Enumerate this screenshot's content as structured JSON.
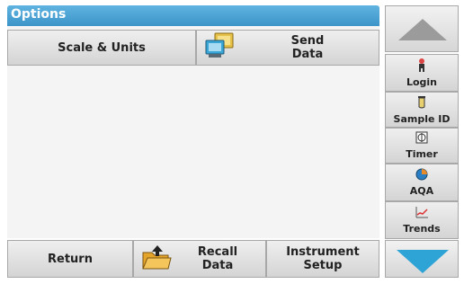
{
  "header": {
    "title": "Options"
  },
  "main": {
    "scale_units_label": "Scale & Units",
    "send_data_label": "Send\nData"
  },
  "footer": {
    "return_label": "Return",
    "recall_data_label": "Recall\nData",
    "instrument_setup_label": "Instrument\nSetup"
  },
  "sidebar": {
    "login_label": "Login",
    "sample_id_label": "Sample ID",
    "timer_label": "Timer",
    "aqa_label": "AQA",
    "trends_label": "Trends"
  },
  "colors": {
    "title_bar": "#4aa3d6",
    "button_face": "#e2e2e2",
    "arrow": "#999999",
    "scroll_down_arrow": "#2ea3d6"
  }
}
